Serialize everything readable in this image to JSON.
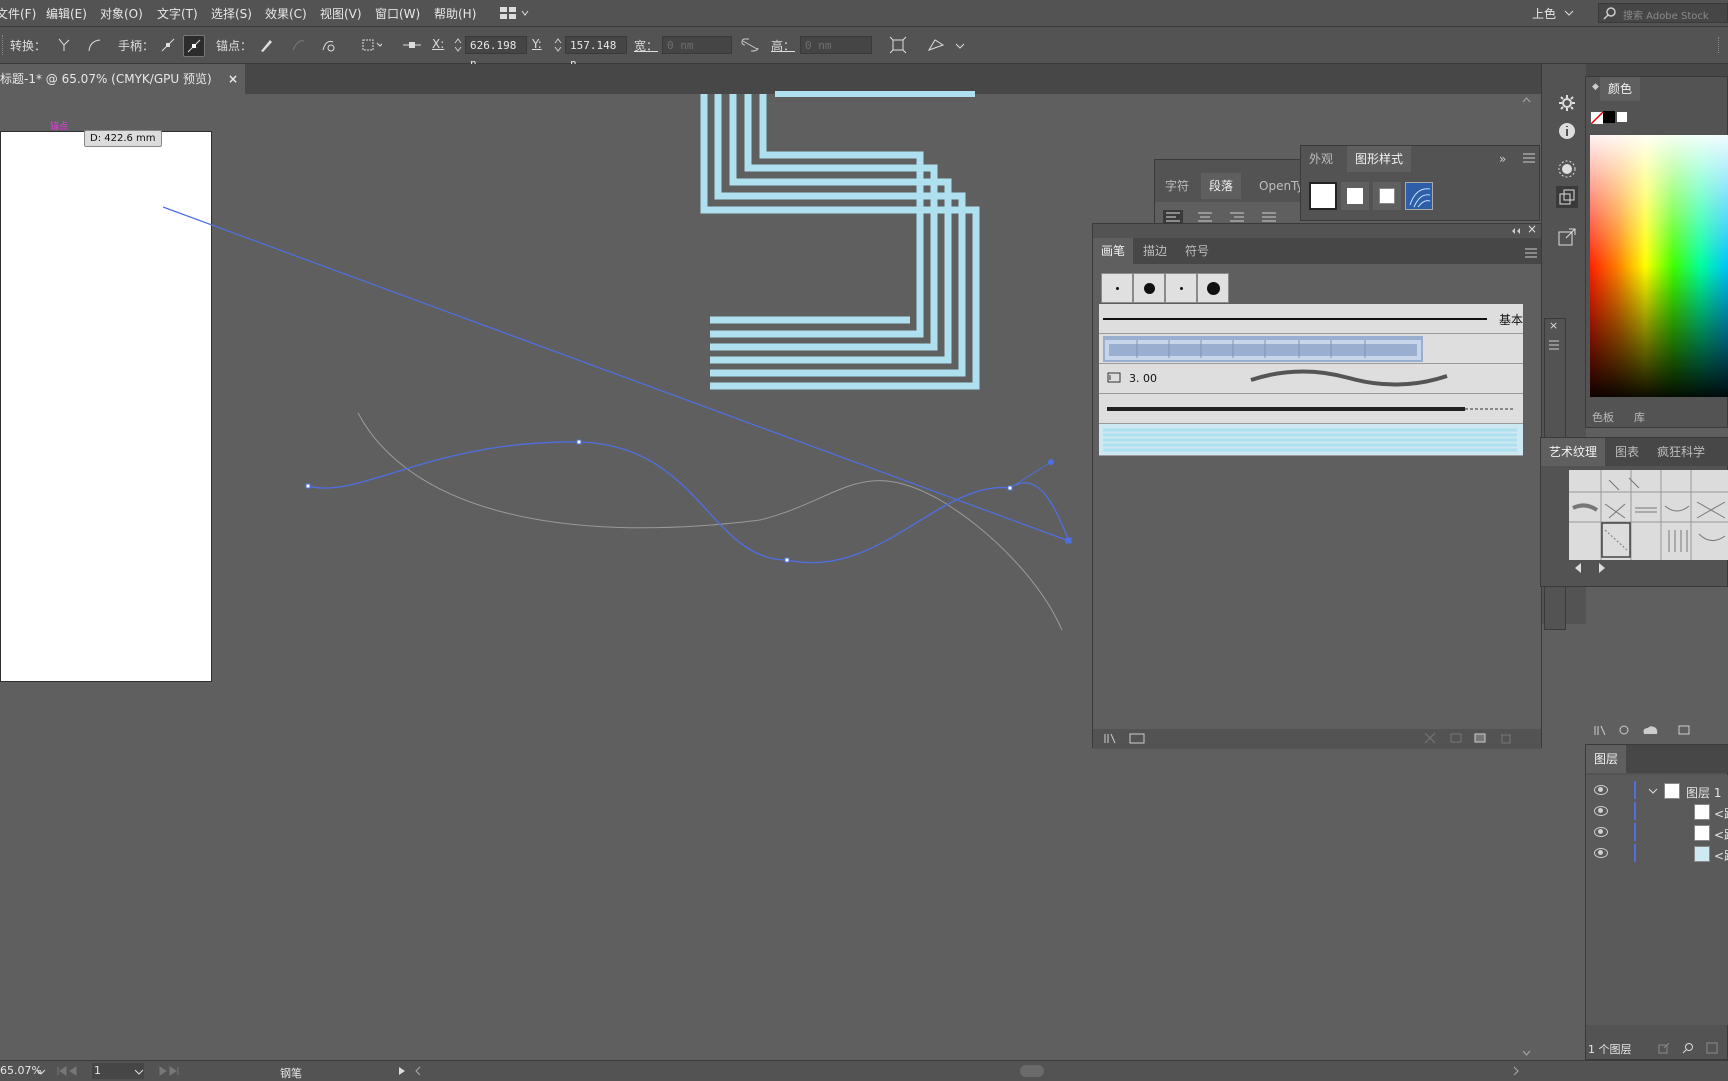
{
  "menu": {
    "items": [
      "文件(F)",
      "编辑(E)",
      "对象(O)",
      "文字(T)",
      "选择(S)",
      "效果(C)",
      "视图(V)",
      "窗口(W)",
      "帮助(H)"
    ],
    "workspace": "上色",
    "search_placeholder": "搜索 Adobe Stock"
  },
  "control_bar": {
    "convert_label": "转换：",
    "handle_label": "手柄：",
    "anchor_label": "锚点：",
    "x_label": "X:",
    "x_value": "626.198 n",
    "y_label": "Y:",
    "y_value": "157.148 n",
    "width_label": "宽：",
    "width_value": "0 nm",
    "height_label": "高：",
    "height_value": "0 nm"
  },
  "document_tab": {
    "title": "标题-1* @ 65.07% (CMYK/GPU 预览)",
    "close": "×"
  },
  "canvas": {
    "anchor_hint": "锚点",
    "distance_tooltip": "D: 422.6 mm"
  },
  "char_panel": {
    "tabs": [
      "字符",
      "段落",
      "OpenType"
    ]
  },
  "appearance_panel": {
    "tabs": [
      "外观",
      "图形样式"
    ]
  },
  "brushes_panel": {
    "tabs": [
      "画笔",
      "描边",
      "符号"
    ],
    "basic_label": "基本",
    "size_value": "3. 00"
  },
  "color_panel": {
    "title": "颜色",
    "lower_tabs": [
      "色板",
      "库"
    ]
  },
  "art_texture_panel": {
    "tabs": [
      "艺术纹理",
      "图表",
      "疯狂科学"
    ]
  },
  "layers_panel": {
    "title": "图层",
    "layer_name": "图层 1",
    "sublayer_label": "<路",
    "footer_count": "1 个图层"
  },
  "status_bar": {
    "zoom": "65.07%",
    "artboard_num": "1",
    "tool_name": "钢笔"
  },
  "colors": {
    "accent_path": "#4f6fe0",
    "cyan_art": "#aee0ef"
  }
}
